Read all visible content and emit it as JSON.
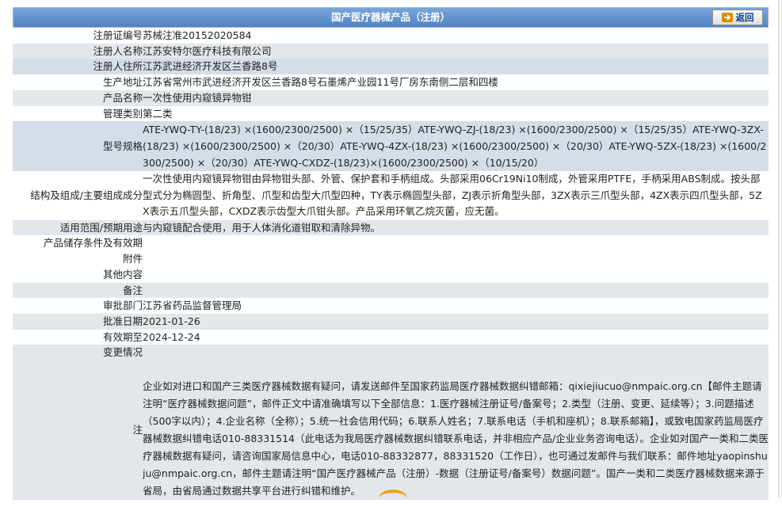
{
  "header": {
    "title": "国产医疗器械产品（注册）",
    "back_label": "返回"
  },
  "rows": [
    {
      "label": "注册证编号",
      "value": "苏械注准20152020584"
    },
    {
      "label": "注册人名称",
      "value": "江苏安特尔医疗科技有限公司"
    },
    {
      "label": "注册人住所",
      "value": "江苏武进经济开发区兰香路8号"
    },
    {
      "label": "生产地址",
      "value": "江苏省常州市武进经济开发区兰香路8号石墨烯产业园11号厂房东南侧二层和四楼"
    },
    {
      "label": "产品名称",
      "value": "一次性使用内窥镜异物钳"
    },
    {
      "label": "管理类别",
      "value": "第二类"
    },
    {
      "label": "型号规格",
      "value": "ATE-YWQ-TY-(18/23) ×(1600/2300/2500) ×（15/25/35）ATE-YWQ-ZJ-(18/23) ×(1600/2300/2500) ×（15/25/35）ATE-YWQ-3ZX-(18/23) ×(1600/2300/2500) ×（20/30）ATE-YWQ-4ZX-(18/23) ×(1600/2300/2500) ×（20/30）ATE-YWQ-5ZX-(18/23) ×(1600/2300/2500) ×（20/30）ATE-YWQ-CXDZ-(18/23)×(1600/2300/2500) ×（10/15/20）"
    },
    {
      "label": "结构及组成/主要组成成分",
      "value": "一次性使用内窥镜异物钳由异物钳头部、外管、保护套和手柄组成。头部采用06Cr19Ni10制成，外管采用PTFE，手柄采用ABS制成。按头部型式分为椭圆型、折角型、爪型和齿型大爪型四种，TY表示椭圆型头部，ZJ表示折角型头部，3ZX表示三爪型头部，4ZX表示四爪型头部，5ZX表示五爪型头部，CXDZ表示齿型大爪钳头部。产品采用环氧乙烷灭菌，应无菌。"
    },
    {
      "label": "适用范围/预期用途",
      "value": "与内窥镜配合使用，用于人体消化道钳取和清除异物。"
    },
    {
      "label": "产品储存条件及有效期",
      "value": ""
    },
    {
      "label": "附件",
      "value": ""
    },
    {
      "label": "其他内容",
      "value": ""
    },
    {
      "label": "备注",
      "value": ""
    },
    {
      "label": "审批部门",
      "value": "江苏省药品监督管理局"
    },
    {
      "label": "批准日期",
      "value": "2021-01-26"
    },
    {
      "label": "有效期至",
      "value": "2024-12-24"
    },
    {
      "label": "变更情况",
      "value": ""
    },
    {
      "label": "注",
      "value": "企业如对进口和国产三类医疗器械数据有疑问，请发送邮件至国家药监局医疗器械数据纠错邮箱：qixiejiucuo@nmpaic.org.cn【邮件主题请注明“医疗器械数据问题”，邮件正文中请准确填写以下全部信息：1.医疗器械注册证号/备案号；2.类型（注册、变更、延续等）；3.问题描述（500字以内）；4.企业名称（全称）；5.统一社会信用代码；6.联系人姓名；7.联系电话（手机和座机）；8.联系邮箱】，或致电国家药监局医疗器械数据纠错电话010-88331514（此电话为我局医疗器械数据纠错联系电话，并非相应产品/企业业务咨询电话）。企业如对国产一类和二类医疗器械数据有疑问，请咨询国家局信息中心，电话010-88332877，88331520（工作日），也可通过发邮件与我们联系：邮件地址yaopinshuju@nmpaic.org.cn，邮件主题请注明“国产医疗器械产品（注册）-数据（注册证号/备案号）数据问题”。国产一类和二类医疗器械数据来源于省局，由省局通过数据共享平台进行纠错和维护。"
    }
  ]
}
